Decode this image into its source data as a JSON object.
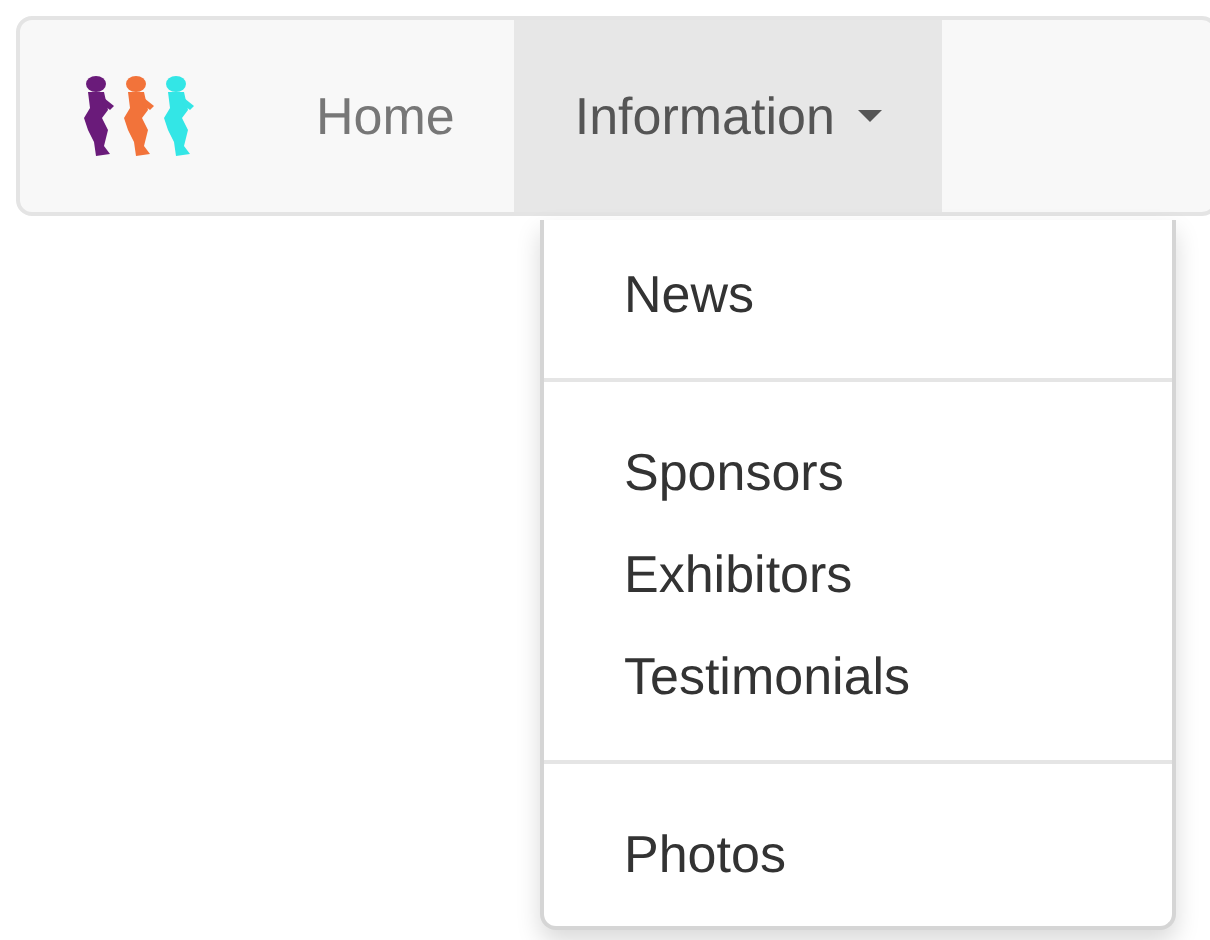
{
  "navbar": {
    "items": [
      {
        "label": "Home",
        "selected": false,
        "has_caret": false
      },
      {
        "label": "Information",
        "selected": true,
        "has_caret": true
      }
    ]
  },
  "dropdown": {
    "items": [
      {
        "kind": "link",
        "label": "News"
      },
      {
        "kind": "divider"
      },
      {
        "kind": "link",
        "label": "Sponsors"
      },
      {
        "kind": "link",
        "label": "Exhibitors"
      },
      {
        "kind": "link",
        "label": "Testimonials"
      },
      {
        "kind": "divider"
      },
      {
        "kind": "link",
        "label": "Photos"
      }
    ]
  }
}
